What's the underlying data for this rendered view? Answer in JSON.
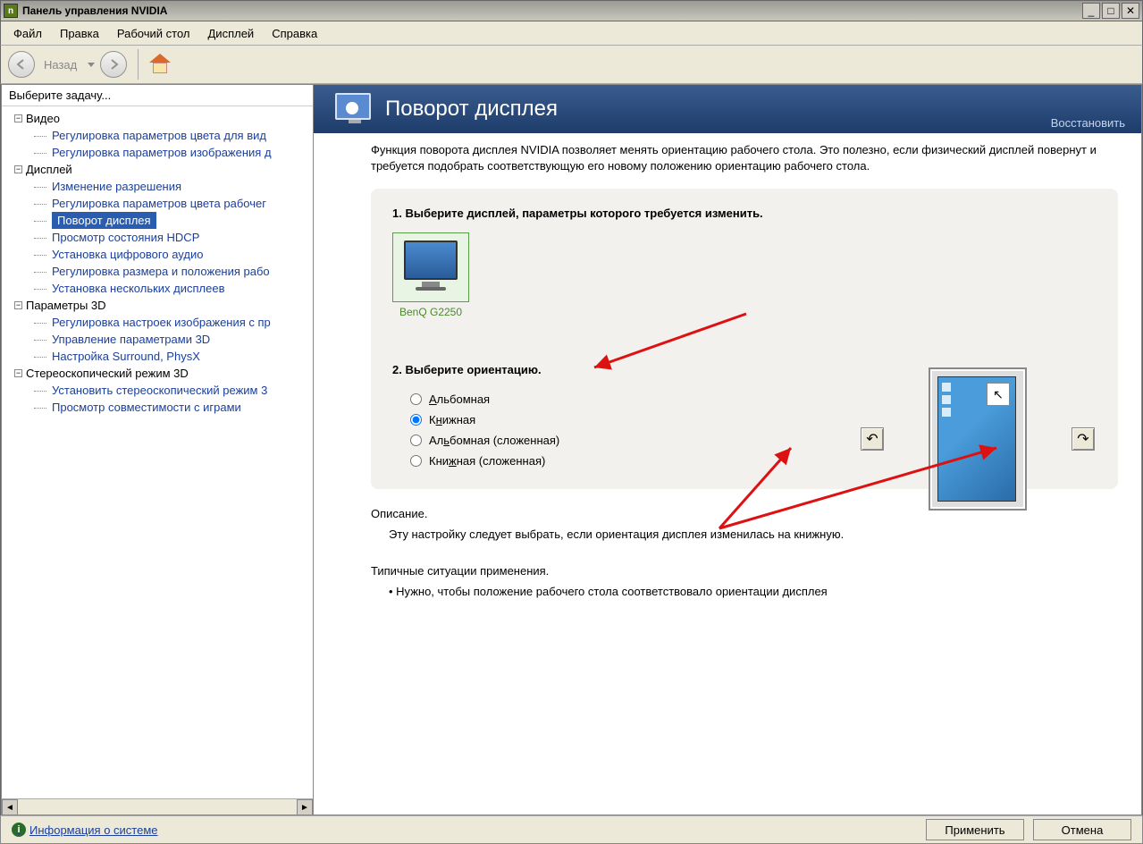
{
  "window": {
    "title": "Панель управления NVIDIA"
  },
  "menubar": [
    "Файл",
    "Правка",
    "Рабочий стол",
    "Дисплей",
    "Справка"
  ],
  "toolbar": {
    "back_label": "Назад"
  },
  "sidebar": {
    "header": "Выберите задачу...",
    "categories": [
      {
        "label": "Видео",
        "items": [
          "Регулировка параметров цвета для вид",
          "Регулировка параметров изображения д"
        ]
      },
      {
        "label": "Дисплей",
        "items": [
          "Изменение разрешения",
          "Регулировка параметров цвета рабочег",
          "Поворот дисплея",
          "Просмотр состояния HDCP",
          "Установка цифрового аудио",
          "Регулировка размера и положения рабо",
          "Установка нескольких дисплеев"
        ]
      },
      {
        "label": "Параметры 3D",
        "items": [
          "Регулировка настроек изображения с пр",
          "Управление параметрами 3D",
          "Настройка Surround, PhysX"
        ]
      },
      {
        "label": "Стереоскопический режим 3D",
        "items": [
          "Установить стереоскопический режим 3",
          "Просмотр совместимости с играми"
        ]
      }
    ],
    "selected": "Поворот дисплея"
  },
  "content": {
    "header_title": "Поворот дисплея",
    "restore": "Восстановить",
    "intro": "Функция поворота дисплея NVIDIA позволяет менять ориентацию рабочего стола. Это полезно, если физический дисплей повернут и требуется подобрать соответствующую его новому положению ориентацию рабочего стола.",
    "step1_title": "1. Выберите дисплей, параметры которого требуется изменить.",
    "display_name": "BenQ G2250",
    "step2_title": "2. Выберите ориентацию.",
    "orientations": [
      {
        "label": "Альбомная",
        "accel_html": "<u>А</u>льбомная",
        "checked": false
      },
      {
        "label": "Книжная",
        "accel_html": "К<u>н</u>ижная",
        "checked": true
      },
      {
        "label": "Альбомная (сложенная)",
        "accel_html": "Ал<u>ь</u>бомная (сложенная)",
        "checked": false
      },
      {
        "label": "Книжная (сложенная)",
        "accel_html": "Кни<u>ж</u>ная (сложенная)",
        "checked": false
      }
    ],
    "desc_label": "Описание.",
    "desc_text": "Эту настройку следует выбрать, если ориентация дисплея изменилась на книжную.",
    "usage_label": "Типичные ситуации применения.",
    "usage_item": "• Нужно, чтобы положение рабочего стола соответствовало ориентации дисплея"
  },
  "footer": {
    "info_link": "Информация о системе",
    "apply": "Применить",
    "cancel": "Отмена"
  }
}
